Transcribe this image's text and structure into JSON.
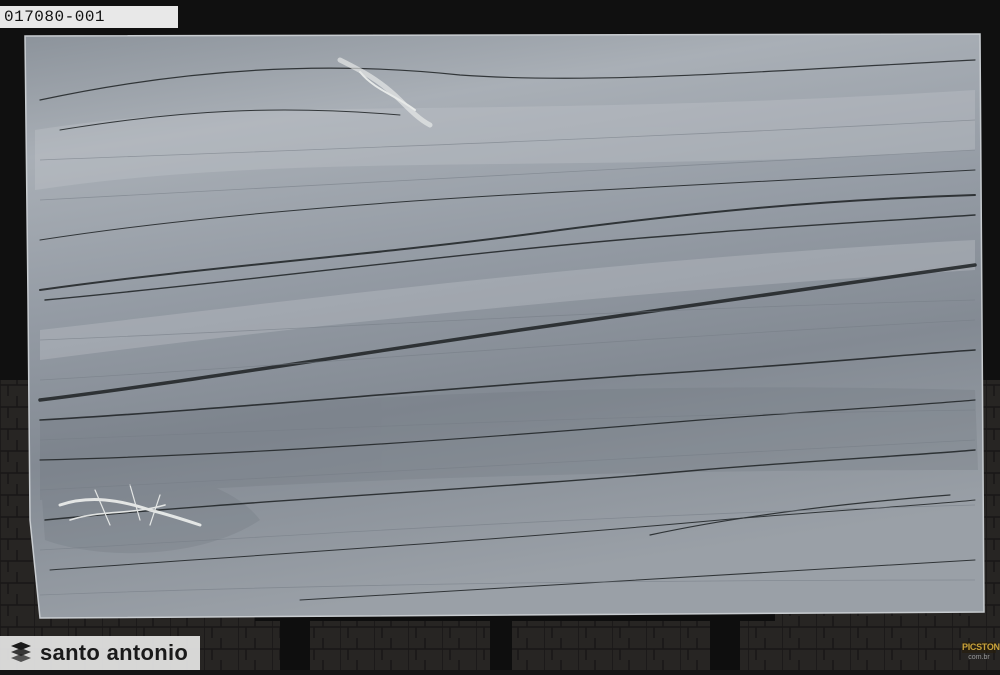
{
  "slab": {
    "id_label": "017080-001",
    "material_colors": {
      "base": "#8a9099",
      "light_band": "#a7adb4",
      "dark_vein": "#1e2224",
      "white_vein": "#eef0ee",
      "pavement": "#2e2b29"
    }
  },
  "branding": {
    "company_name": "santo antonio",
    "logo_icon": "stacked-slabs-icon"
  },
  "watermark": {
    "brand": "PICSTONE",
    "domain": "com.br"
  }
}
